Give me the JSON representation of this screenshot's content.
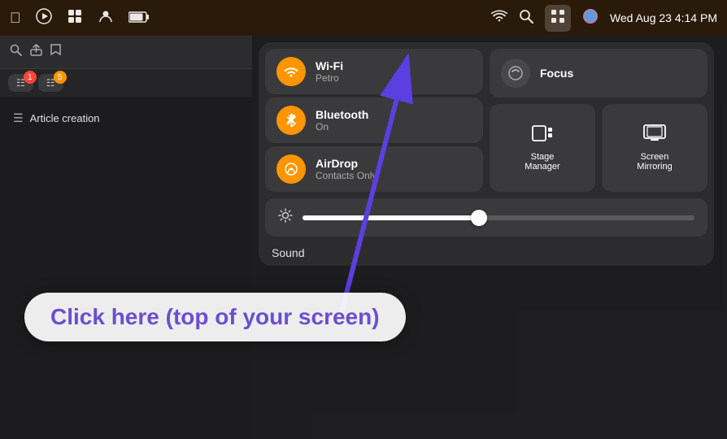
{
  "menubar": {
    "datetime": "Wed Aug 23  4:14 PM",
    "icons": [
      "apple",
      "play",
      "grid",
      "person",
      "battery",
      "wifi",
      "search",
      "control-center",
      "siri"
    ]
  },
  "control_center": {
    "wifi": {
      "title": "Wi-Fi",
      "subtitle": "Petro"
    },
    "bluetooth": {
      "title": "Bluetooth",
      "subtitle": "On"
    },
    "airdrop": {
      "title": "AirDrop",
      "subtitle": "Contacts Only"
    },
    "focus": {
      "title": "Focus"
    },
    "stage_manager": {
      "label": "Stage\nManager"
    },
    "screen_mirroring": {
      "label": "Screen\nMirroring"
    },
    "sound_label": "Sound"
  },
  "browser": {
    "sidebar_item": "Article creation"
  },
  "annotation": {
    "click_here": "Click here (top of your screen)"
  },
  "toolbar": {
    "tab_badge": "1",
    "tab_badge2": "5"
  }
}
